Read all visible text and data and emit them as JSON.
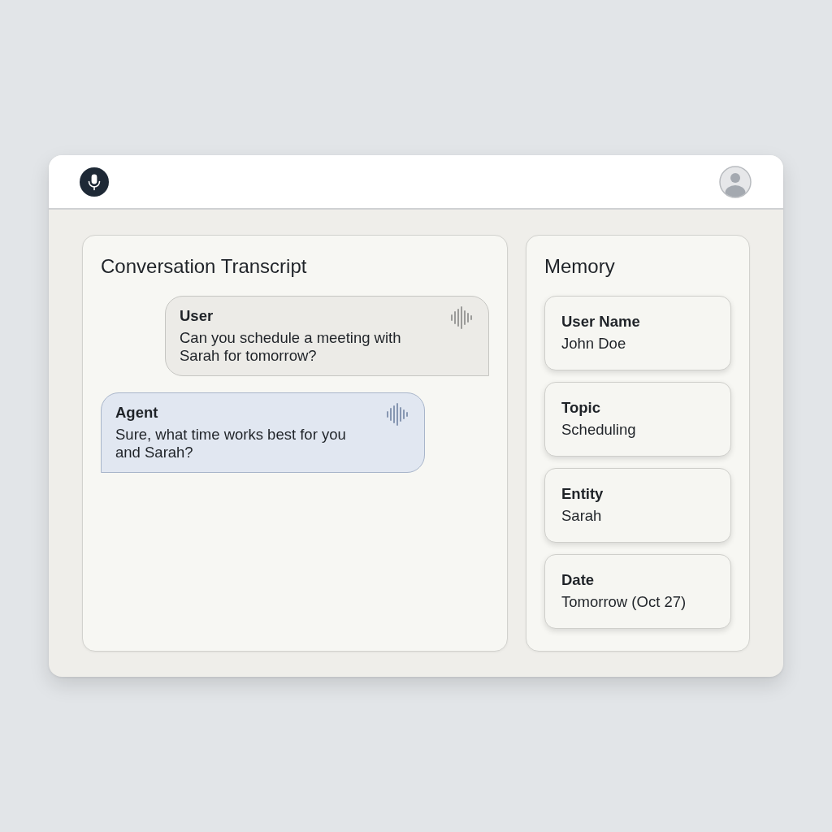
{
  "transcript": {
    "title": "Conversation Transcript",
    "messages": [
      {
        "kind": "user",
        "speaker": "User",
        "text": "Can you schedule a meeting with Sarah for tomorrow?"
      },
      {
        "kind": "agent",
        "speaker": "Agent",
        "text": "Sure, what time works best for you and Sarah?"
      }
    ]
  },
  "memory": {
    "title": "Memory",
    "items": [
      {
        "label": "User Name",
        "value": "John Doe"
      },
      {
        "label": "Topic",
        "value": "Scheduling"
      },
      {
        "label": "Entity",
        "value": "Sarah"
      },
      {
        "label": "Date",
        "value": "Tomorrow (Oct 27)"
      }
    ]
  }
}
